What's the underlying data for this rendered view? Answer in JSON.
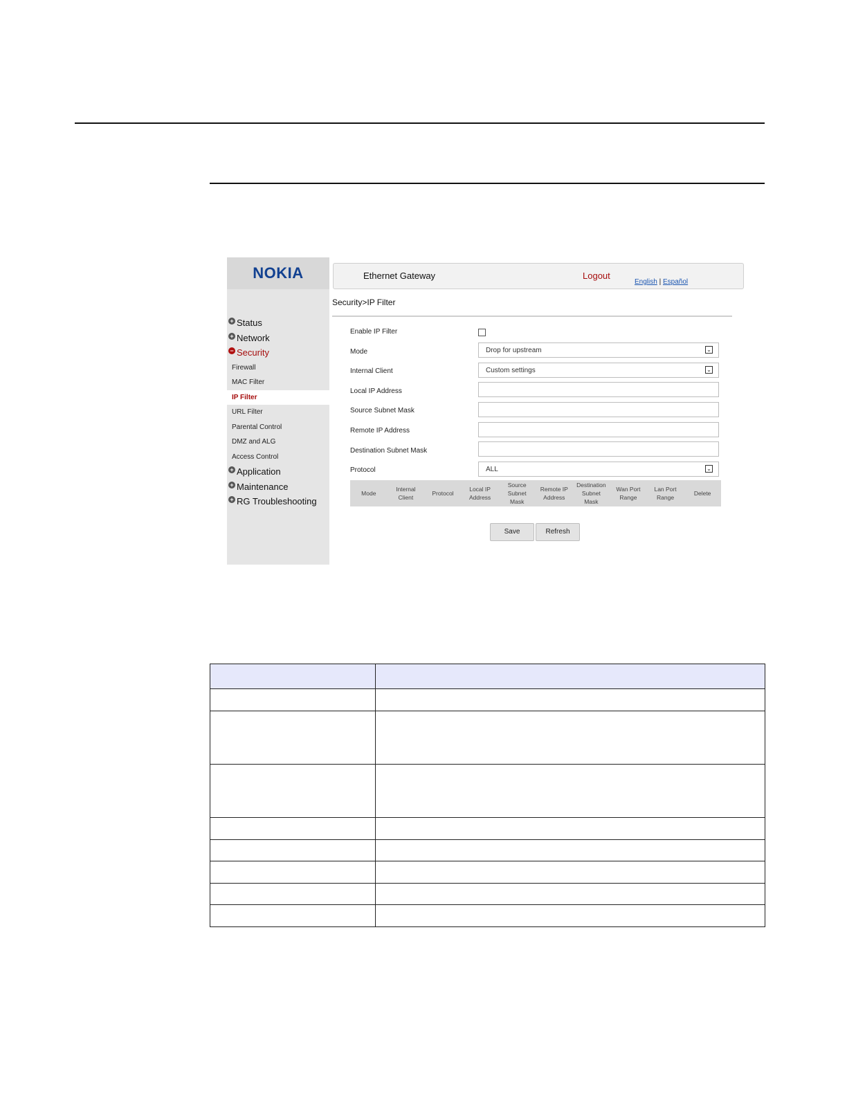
{
  "app": {
    "logo": "NOKIA",
    "title": "Ethernet Gateway",
    "logout": "Logout",
    "lang_english": "English",
    "lang_separator": "|",
    "lang_spanish": "Español",
    "breadcrumb": "Security>IP Filter"
  },
  "sidebar": {
    "items": [
      {
        "label": "Status"
      },
      {
        "label": "Network"
      },
      {
        "label": "Security"
      },
      {
        "label": "Firewall"
      },
      {
        "label": "MAC Filter"
      },
      {
        "label": "IP Filter"
      },
      {
        "label": "URL Filter"
      },
      {
        "label": "Parental Control"
      },
      {
        "label": "DMZ and ALG"
      },
      {
        "label": "Access Control"
      },
      {
        "label": "Application"
      },
      {
        "label": "Maintenance"
      },
      {
        "label": "RG Troubleshooting"
      }
    ]
  },
  "form": {
    "enable_label": "Enable IP Filter",
    "enable_checked": false,
    "mode_label": "Mode",
    "mode_value": "Drop for upstream",
    "internal_client_label": "Internal Client",
    "internal_client_value": "Custom settings",
    "local_ip_label": "Local IP Address",
    "local_ip_value": "",
    "source_mask_label": "Source Subnet Mask",
    "source_mask_value": "",
    "remote_ip_label": "Remote IP Address",
    "remote_ip_value": "",
    "dest_mask_label": "Destination Subnet Mask",
    "dest_mask_value": "",
    "protocol_label": "Protocol",
    "protocol_value": "ALL"
  },
  "table": {
    "columns": [
      "Mode",
      "Internal Client",
      "Protocol",
      "Local IP Address",
      "Source Subnet Mask",
      "Remote IP Address",
      "Destination Subnet Mask",
      "Wan Port Range",
      "Lan Port Range",
      "Delete"
    ]
  },
  "buttons": {
    "save": "Save",
    "refresh": "Refresh"
  },
  "colors": {
    "brand": "#124191",
    "active": "#a60d0d",
    "link": "#1a55b0",
    "doc_table_header": "#e6e8fb"
  }
}
